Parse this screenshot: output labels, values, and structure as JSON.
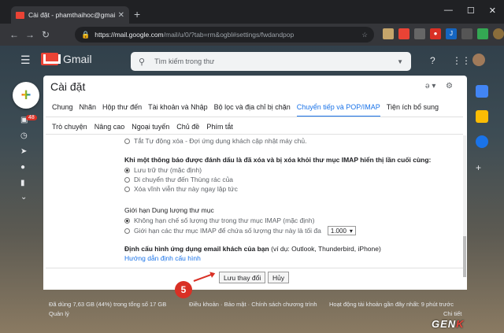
{
  "browser": {
    "tab_title": "Cài đặt - phamthaihoc@gmail.co",
    "url_proto": "https://mail.google.com",
    "url_rest": "/mail/u/0/?tab=rm&ogbl#settings/fwdandpop"
  },
  "gmail": {
    "product": "Gmail",
    "search_placeholder": "Tìm kiếm trong thư",
    "badge_count": "48",
    "page_title": "Cài đặt"
  },
  "tabs_row1": [
    "Chung",
    "Nhãn",
    "Hộp thư đến",
    "Tài khoản và Nhập",
    "Bộ lọc và địa chỉ bị chặn",
    "Chuyển tiếp và POP/IMAP",
    "Tiện ích bổ sung"
  ],
  "tabs_row2": [
    "Trò chuyện",
    "Nâng cao",
    "Ngoại tuyến",
    "Chủ đề",
    "Phím tắt"
  ],
  "settings": {
    "autoexpunge_off": "Tắt Tự động xóa - Đợi ứng dụng khách cập nhật máy chủ.",
    "deleted_heading": "Khi một thông báo được đánh dấu là đã xóa và bị xóa khỏi thư mục IMAP hiển thị lần cuối cùng:",
    "opt_archive": "Lưu trữ thư (mặc định)",
    "opt_trash": "Di chuyển thư đến Thùng rác của",
    "opt_delete": "Xóa vĩnh viễn thư này ngay lập tức",
    "folder_heading": "Giới hạn Dung lượng thư mục",
    "opt_nolimit": "Không hạn chế số lượng thư trong thư mục IMAP (mặc định)",
    "opt_limit": "Giới hạn các thư mục IMAP để chứa số lượng thư này là tối đa",
    "limit_value": "1.000",
    "config_heading": "Định cấu hình ứng dụng email khách của bạn",
    "config_example": "(ví dụ: Outlook, Thunderbird, iPhone)",
    "config_link": "Hướng dẫn định cấu hình"
  },
  "buttons": {
    "save": "Lưu thay đổi",
    "cancel": "Hủy"
  },
  "annotation_number": "5",
  "footer": {
    "storage": "Đã dùng 7,63 GB (44%) trong tổng số 17 GB",
    "manage": "Quản lý",
    "terms": "Điều khoản · Bảo mật · Chính sách chương trình",
    "activity": "Hoạt động tài khoản gần đây nhất: 9 phút trước",
    "details": "Chi tiết"
  },
  "watermark": "GENK"
}
